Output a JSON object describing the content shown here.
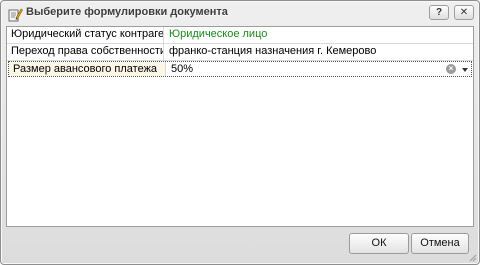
{
  "window": {
    "title": "Выберите формулировки документа",
    "help_button": "?",
    "close_button": "✕"
  },
  "grid": {
    "rows": [
      {
        "label": "Юридический статус контрагента",
        "value": "Юридическое лицо",
        "value_color": "#1b8a1b"
      },
      {
        "label": "Переход права собственности",
        "value": "франко-станция назначения г. Кемерово"
      },
      {
        "label": "Размер авансового платежа",
        "value": "50%",
        "selected": true
      }
    ]
  },
  "buttons": {
    "ok": "ОК",
    "cancel": "Отмена"
  },
  "icons": {
    "title": "document-pencil-icon",
    "clear": "clear-circle-icon",
    "dropdown": "chevron-down-icon"
  }
}
